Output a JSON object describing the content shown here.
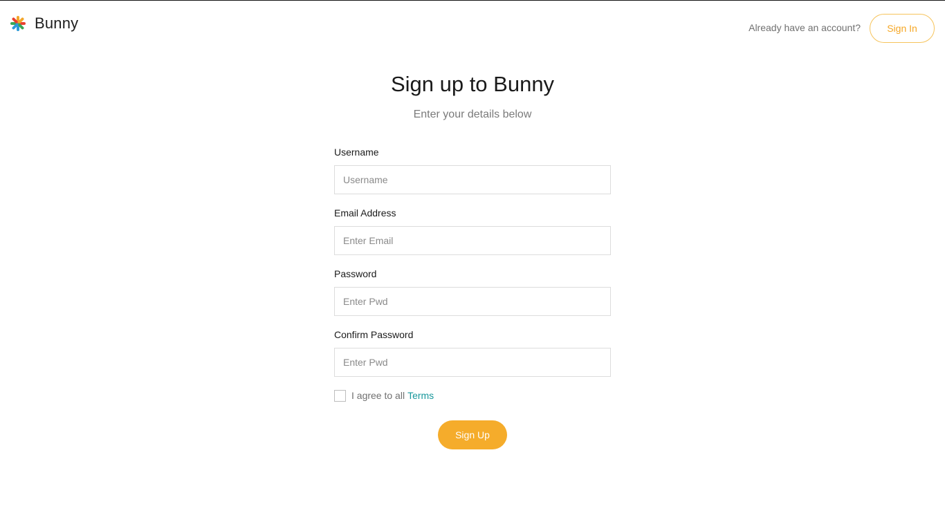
{
  "header": {
    "brand_name": "Bunny",
    "logo_icon": "asterisk-flower-icon",
    "account_prompt": "Already have an account?",
    "signin_label": "Sign In"
  },
  "main": {
    "title": "Sign up to Bunny",
    "subtitle": "Enter your details below"
  },
  "form": {
    "username": {
      "label": "Username",
      "placeholder": "Username",
      "value": ""
    },
    "email": {
      "label": "Email Address",
      "placeholder": "Enter Email",
      "value": ""
    },
    "password": {
      "label": "Password",
      "placeholder": "Enter Pwd",
      "value": ""
    },
    "confirm_password": {
      "label": "Confirm Password",
      "placeholder": "Enter Pwd",
      "value": ""
    },
    "terms": {
      "prefix": "I agree to all",
      "link_label": "Terms",
      "checked": false
    },
    "submit_label": "Sign Up"
  },
  "colors": {
    "accent": "#f5ac2b",
    "signin_text": "#f5a623",
    "link": "#17979b"
  }
}
